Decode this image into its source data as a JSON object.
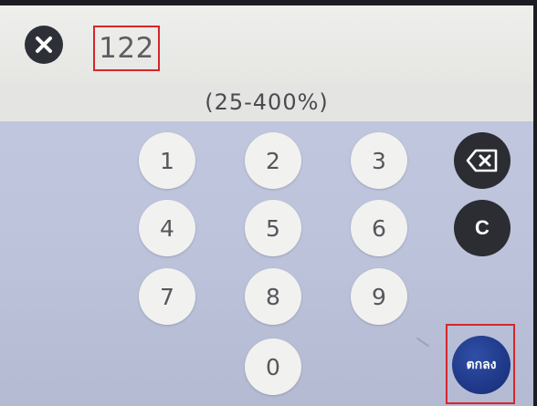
{
  "header": {
    "close_icon": "close-icon",
    "value": "122"
  },
  "range_hint": "(25-400%)",
  "keypad": {
    "digits": [
      "1",
      "2",
      "3",
      "4",
      "5",
      "6",
      "7",
      "8",
      "9",
      "0"
    ]
  },
  "actions": {
    "backspace_icon": "backspace-icon",
    "clear_label": "C",
    "ok_label": "ตกลง"
  },
  "colors": {
    "highlight": "#d6262a",
    "ok_button": "#1d3584",
    "dark_button": "#2b2d33"
  }
}
